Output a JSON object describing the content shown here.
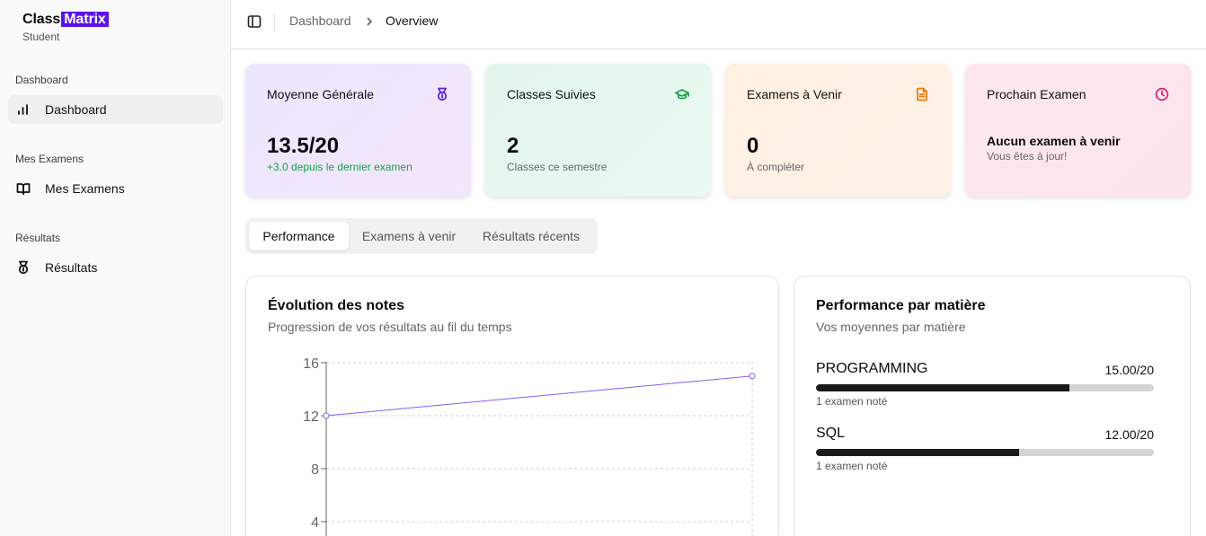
{
  "brand": {
    "part1": "Class",
    "part2": "Matrix",
    "subtitle": "Student",
    "accent": "#5b13e8"
  },
  "sidebar": {
    "sections": [
      {
        "title": "Dashboard",
        "item": {
          "label": "Dashboard",
          "icon": "bar-chart-icon",
          "active": true
        }
      },
      {
        "title": "Mes Examens",
        "item": {
          "label": "Mes Examens",
          "icon": "book-open-icon",
          "active": false
        }
      },
      {
        "title": "Résultats",
        "item": {
          "label": "Résultats",
          "icon": "medal-icon",
          "active": false
        }
      }
    ]
  },
  "header": {
    "toggle_icon": "sidebar-toggle-icon",
    "breadcrumb": [
      "Dashboard",
      "Overview"
    ]
  },
  "cards": [
    {
      "title": "Moyenne Générale",
      "icon": "medal-icon",
      "icon_color": "#5b21d6",
      "value": "13.5/20",
      "sub": "+3.0 depuis le dernier examen",
      "sub_color": "#16a34a"
    },
    {
      "title": "Classes Suivies",
      "icon": "graduation-cap-icon",
      "icon_color": "#16a34a",
      "value": "2",
      "sub": "Classes ce semestre"
    },
    {
      "title": "Examens à Venir",
      "icon": "file-text-icon",
      "icon_color": "#ea7a0c",
      "value": "0",
      "sub": "À compléter"
    },
    {
      "title": "Prochain Examen",
      "icon": "clock-icon",
      "icon_color": "#db2777",
      "value": "Aucun examen à venir",
      "sub": "Vous êtes à jour!"
    }
  ],
  "tabs": [
    {
      "label": "Performance",
      "active": true
    },
    {
      "label": "Examens à venir",
      "active": false
    },
    {
      "label": "Résultats récents",
      "active": false
    }
  ],
  "evolution": {
    "title": "Évolution des notes",
    "description": "Progression de vos résultats au fil du temps"
  },
  "chart_data": {
    "type": "line",
    "title": "Évolution des notes",
    "xlabel": "",
    "ylabel": "",
    "yticks": [
      4,
      8,
      12,
      16
    ],
    "ylim": [
      0,
      16
    ],
    "grid": true,
    "series": [
      {
        "points": [
          [
            0,
            12
          ],
          [
            1,
            15
          ]
        ],
        "color": "#8b5cf6"
      }
    ]
  },
  "subjects": {
    "title": "Performance par matière",
    "description": "Vos moyennes par matière",
    "items": [
      {
        "name": "PROGRAMMING",
        "score": "15.00/20",
        "value": 15,
        "max": 20,
        "note": "1 examen noté"
      },
      {
        "name": "SQL",
        "score": "12.00/20",
        "value": 12,
        "max": 20,
        "note": "1 examen noté"
      }
    ]
  }
}
